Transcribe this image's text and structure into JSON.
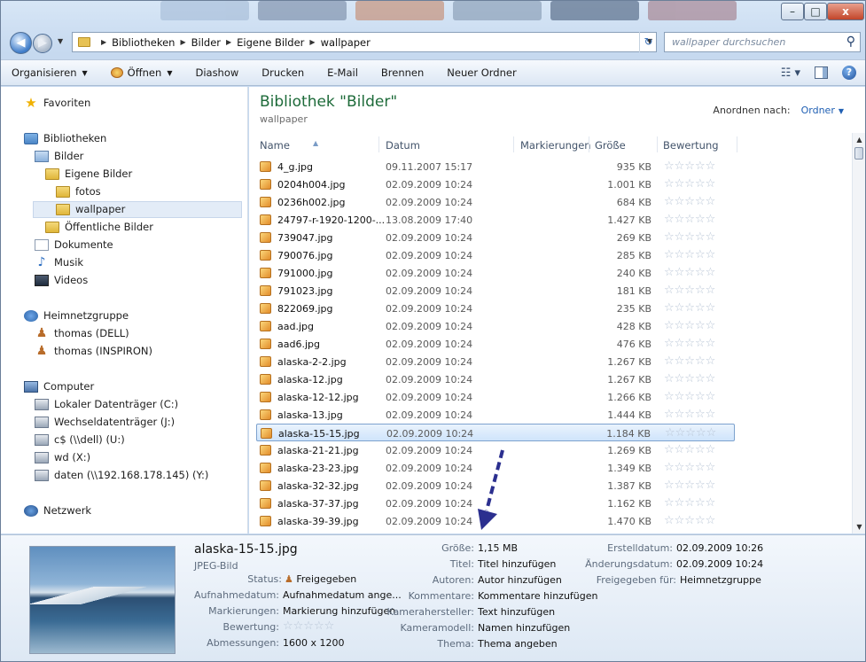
{
  "window": {
    "min": "–",
    "max": "□",
    "close": "x"
  },
  "address": {
    "crumbs": [
      "Bibliotheken",
      "Bilder",
      "Eigene Bilder",
      "wallpaper"
    ],
    "search_placeholder": "wallpaper durchsuchen"
  },
  "toolbar": {
    "organize": "Organisieren",
    "open": "Öffnen",
    "slideshow": "Diashow",
    "print": "Drucken",
    "email": "E-Mail",
    "burn": "Brennen",
    "new_folder": "Neuer Ordner"
  },
  "nav": {
    "favorites": "Favoriten",
    "libraries": "Bibliotheken",
    "pictures": "Bilder",
    "my_pictures": "Eigene Bilder",
    "fotos": "fotos",
    "wallpaper": "wallpaper",
    "public_pictures": "Öffentliche Bilder",
    "documents": "Dokumente",
    "music": "Musik",
    "videos": "Videos",
    "homegroup": "Heimnetzgruppe",
    "user1": "thomas (DELL)",
    "user2": "thomas (INSPIRON)",
    "computer": "Computer",
    "drive_c": "Lokaler Datenträger (C:)",
    "drive_j": "Wechseldatenträger (J:)",
    "drive_u": "c$ (\\\\dell) (U:)",
    "drive_x": "wd (X:)",
    "drive_y": "daten (\\\\192.168.178.145) (Y:)",
    "network": "Netzwerk"
  },
  "content": {
    "title": "Bibliothek \"Bilder\"",
    "subtitle": "wallpaper",
    "arrange_label": "Anordnen nach:",
    "arrange_value": "Ordner",
    "columns": [
      "Name",
      "Datum",
      "Markierungen",
      "Größe",
      "Bewertung"
    ],
    "stars": "☆☆☆☆☆",
    "files": [
      {
        "name": "4_g.jpg",
        "date": "09.11.2007 15:17",
        "size": "935 KB"
      },
      {
        "name": "0204h004.jpg",
        "date": "02.09.2009 10:24",
        "size": "1.001 KB"
      },
      {
        "name": "0236h002.jpg",
        "date": "02.09.2009 10:24",
        "size": "684 KB"
      },
      {
        "name": "24797-r-1920-1200-...",
        "date": "13.08.2009 17:40",
        "size": "1.427 KB"
      },
      {
        "name": "739047.jpg",
        "date": "02.09.2009 10:24",
        "size": "269 KB"
      },
      {
        "name": "790076.jpg",
        "date": "02.09.2009 10:24",
        "size": "285 KB"
      },
      {
        "name": "791000.jpg",
        "date": "02.09.2009 10:24",
        "size": "240 KB"
      },
      {
        "name": "791023.jpg",
        "date": "02.09.2009 10:24",
        "size": "181 KB"
      },
      {
        "name": "822069.jpg",
        "date": "02.09.2009 10:24",
        "size": "235 KB"
      },
      {
        "name": "aad.jpg",
        "date": "02.09.2009 10:24",
        "size": "428 KB"
      },
      {
        "name": "aad6.jpg",
        "date": "02.09.2009 10:24",
        "size": "476 KB"
      },
      {
        "name": "alaska-2-2.jpg",
        "date": "02.09.2009 10:24",
        "size": "1.267 KB"
      },
      {
        "name": "alaska-12.jpg",
        "date": "02.09.2009 10:24",
        "size": "1.267 KB"
      },
      {
        "name": "alaska-12-12.jpg",
        "date": "02.09.2009 10:24",
        "size": "1.266 KB"
      },
      {
        "name": "alaska-13.jpg",
        "date": "02.09.2009 10:24",
        "size": "1.444 KB"
      },
      {
        "name": "alaska-15-15.jpg",
        "date": "02.09.2009 10:24",
        "size": "1.184 KB",
        "selected": true
      },
      {
        "name": "alaska-21-21.jpg",
        "date": "02.09.2009 10:24",
        "size": "1.269 KB"
      },
      {
        "name": "alaska-23-23.jpg",
        "date": "02.09.2009 10:24",
        "size": "1.349 KB"
      },
      {
        "name": "alaska-32-32.jpg",
        "date": "02.09.2009 10:24",
        "size": "1.387 KB"
      },
      {
        "name": "alaska-37-37.jpg",
        "date": "02.09.2009 10:24",
        "size": "1.162 KB"
      },
      {
        "name": "alaska-39-39.jpg",
        "date": "02.09.2009 10:24",
        "size": "1.470 KB"
      }
    ]
  },
  "details": {
    "filename": "alaska-15-15.jpg",
    "filetype": "JPEG-Bild",
    "status_label": "Status:",
    "status_value": "Freigegeben",
    "taken_label": "Aufnahmedatum:",
    "taken_value": "Aufnahmedatum ange...",
    "tags_label": "Markierungen:",
    "tags_value": "Markierung hinzufügen",
    "rating_label": "Bewertung:",
    "rating_value": "☆☆☆☆☆",
    "dims_label": "Abmessungen:",
    "dims_value": "1600 x 1200",
    "size_label": "Größe:",
    "size_value": "1,15 MB",
    "title_label": "Titel:",
    "title_value": "Titel hinzufügen",
    "authors_label": "Autoren:",
    "authors_value": "Autor hinzufügen",
    "comments_label": "Kommentare:",
    "comments_value": "Kommentare hinzufügen",
    "maker_label": "Kamerahersteller:",
    "maker_value": "Text hinzufügen",
    "model_label": "Kameramodell:",
    "model_value": "Namen hinzufügen",
    "subject_label": "Thema:",
    "subject_value": "Thema angeben",
    "created_label": "Erstelldatum:",
    "created_value": "02.09.2009 10:26",
    "modified_label": "Änderungsdatum:",
    "modified_value": "02.09.2009 10:24",
    "shared_label": "Freigegeben für:",
    "shared_value": "Heimnetzgruppe"
  }
}
